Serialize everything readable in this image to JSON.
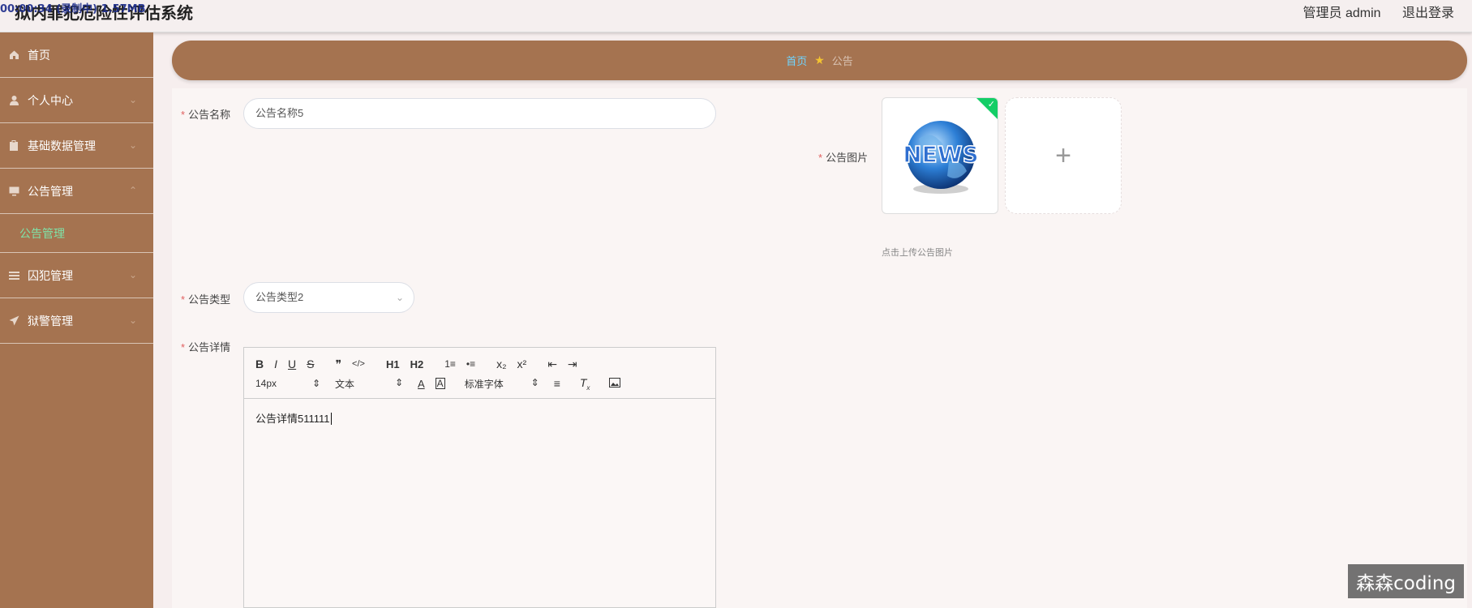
{
  "app": {
    "title": "狱内罪犯危险性评估系统",
    "overlay_text": "00:00:34 (录制中) 1.57MB"
  },
  "header": {
    "user_label": "管理员 admin",
    "logout_label": "退出登录"
  },
  "sidebar": {
    "items": [
      {
        "label": "首页",
        "icon": "home-icon"
      },
      {
        "label": "个人中心",
        "icon": "user-icon"
      },
      {
        "label": "基础数据管理",
        "icon": "clipboard-icon"
      },
      {
        "label": "公告管理",
        "icon": "monitor-icon"
      },
      {
        "label": "囚犯管理",
        "icon": "list-icon"
      },
      {
        "label": "狱警管理",
        "icon": "send-icon"
      }
    ],
    "sub_item": "公告管理"
  },
  "breadcrumb": {
    "home": "首页",
    "current": "公告"
  },
  "form": {
    "name_label": "公告名称",
    "name_value": "公告名称5",
    "image_label": "公告图片",
    "image_thumb_text": "NEWS",
    "image_hint": "点击上传公告图片",
    "type_label": "公告类型",
    "type_value": "公告类型2",
    "detail_label": "公告详情",
    "detail_value": "公告详情511111"
  },
  "editor": {
    "font_size": "14px",
    "text_style": "文本",
    "font_family": "标准字体",
    "buttons": [
      "B",
      "I",
      "U",
      "S",
      "❞",
      "</>",
      "H1",
      "H2",
      "1≡",
      "•≡",
      "x₂",
      "x²",
      "⇤",
      "⇥"
    ]
  },
  "watermark": "森森coding"
}
